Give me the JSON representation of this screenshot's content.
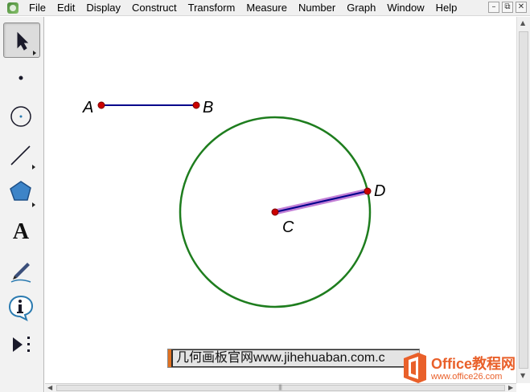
{
  "menu": {
    "items": [
      "File",
      "Edit",
      "Display",
      "Construct",
      "Transform",
      "Measure",
      "Number",
      "Graph",
      "Window",
      "Help"
    ],
    "window_buttons": [
      "–",
      "⧉",
      "✕"
    ]
  },
  "toolbox": {
    "tools": [
      "arrow-select-tool",
      "point-tool",
      "compass-tool",
      "straightedge-tool",
      "polygon-tool",
      "text-tool",
      "marker-tool",
      "information-tool",
      "custom-tool"
    ],
    "text_tool_glyph": "A"
  },
  "sketch": {
    "points": {
      "A": "A",
      "B": "B",
      "C": "C",
      "D": "D"
    },
    "colors": {
      "segment": "#00008b",
      "circle": "#1e7d1e",
      "point": "#cc0000",
      "selection": "#c27fd6"
    }
  },
  "watermark": {
    "text": "几何画板官网www.jihehuaban.com.c"
  },
  "office_logo": {
    "title": "Office教程网",
    "url": "www.office26.com"
  }
}
